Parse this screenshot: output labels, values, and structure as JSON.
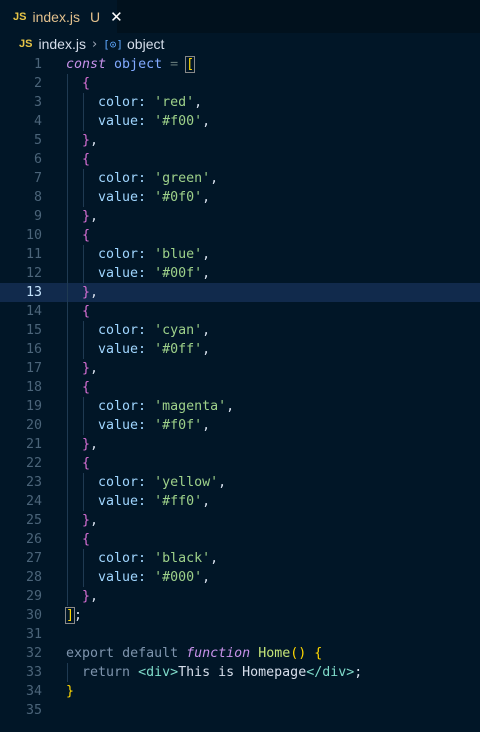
{
  "tab": {
    "lang_badge": "JS",
    "filename": "index.js",
    "status": "U"
  },
  "breadcrumb": {
    "lang_badge": "JS",
    "filename": "index.js",
    "symbol_icon": "[⊙]",
    "symbol": "object"
  },
  "editor": {
    "active_line": 13,
    "lines": [
      {
        "n": "1"
      },
      {
        "n": "2"
      },
      {
        "n": "3"
      },
      {
        "n": "4"
      },
      {
        "n": "5"
      },
      {
        "n": "6"
      },
      {
        "n": "7"
      },
      {
        "n": "8"
      },
      {
        "n": "9"
      },
      {
        "n": "10"
      },
      {
        "n": "11"
      },
      {
        "n": "12"
      },
      {
        "n": "13"
      },
      {
        "n": "14"
      },
      {
        "n": "15"
      },
      {
        "n": "16"
      },
      {
        "n": "17"
      },
      {
        "n": "18"
      },
      {
        "n": "19"
      },
      {
        "n": "20"
      },
      {
        "n": "21"
      },
      {
        "n": "22"
      },
      {
        "n": "23"
      },
      {
        "n": "24"
      },
      {
        "n": "25"
      },
      {
        "n": "26"
      },
      {
        "n": "27"
      },
      {
        "n": "28"
      },
      {
        "n": "29"
      },
      {
        "n": "30"
      },
      {
        "n": "31"
      },
      {
        "n": "32"
      },
      {
        "n": "33"
      },
      {
        "n": "34"
      },
      {
        "n": "35"
      }
    ],
    "tokens": {
      "const": "const",
      "object": "object",
      "eq": "=",
      "lbr": "[",
      "rbr": "]",
      "semi": ";",
      "lcur": "{",
      "rcur": "}",
      "rcur_comma": ",",
      "color_key": "color:",
      "value_key": "value:",
      "comma": ",",
      "items": [
        {
          "color": "'red'",
          "value": "'#f00'"
        },
        {
          "color": "'green'",
          "value": "'#0f0'"
        },
        {
          "color": "'blue'",
          "value": "'#00f'"
        },
        {
          "color": "'cyan'",
          "value": "'#0ff'"
        },
        {
          "color": "'magenta'",
          "value": "'#f0f'"
        },
        {
          "color": "'yellow'",
          "value": "'#ff0'"
        },
        {
          "color": "'black'",
          "value": "'#000'"
        }
      ],
      "export": "export",
      "default": "default",
      "function": "function",
      "home": "Home",
      "parens": "()",
      "return": "return",
      "tag_open": "<div>",
      "tag_text": "This is Homepage",
      "tag_close": "</div>",
      "ret_semi": ";"
    }
  }
}
